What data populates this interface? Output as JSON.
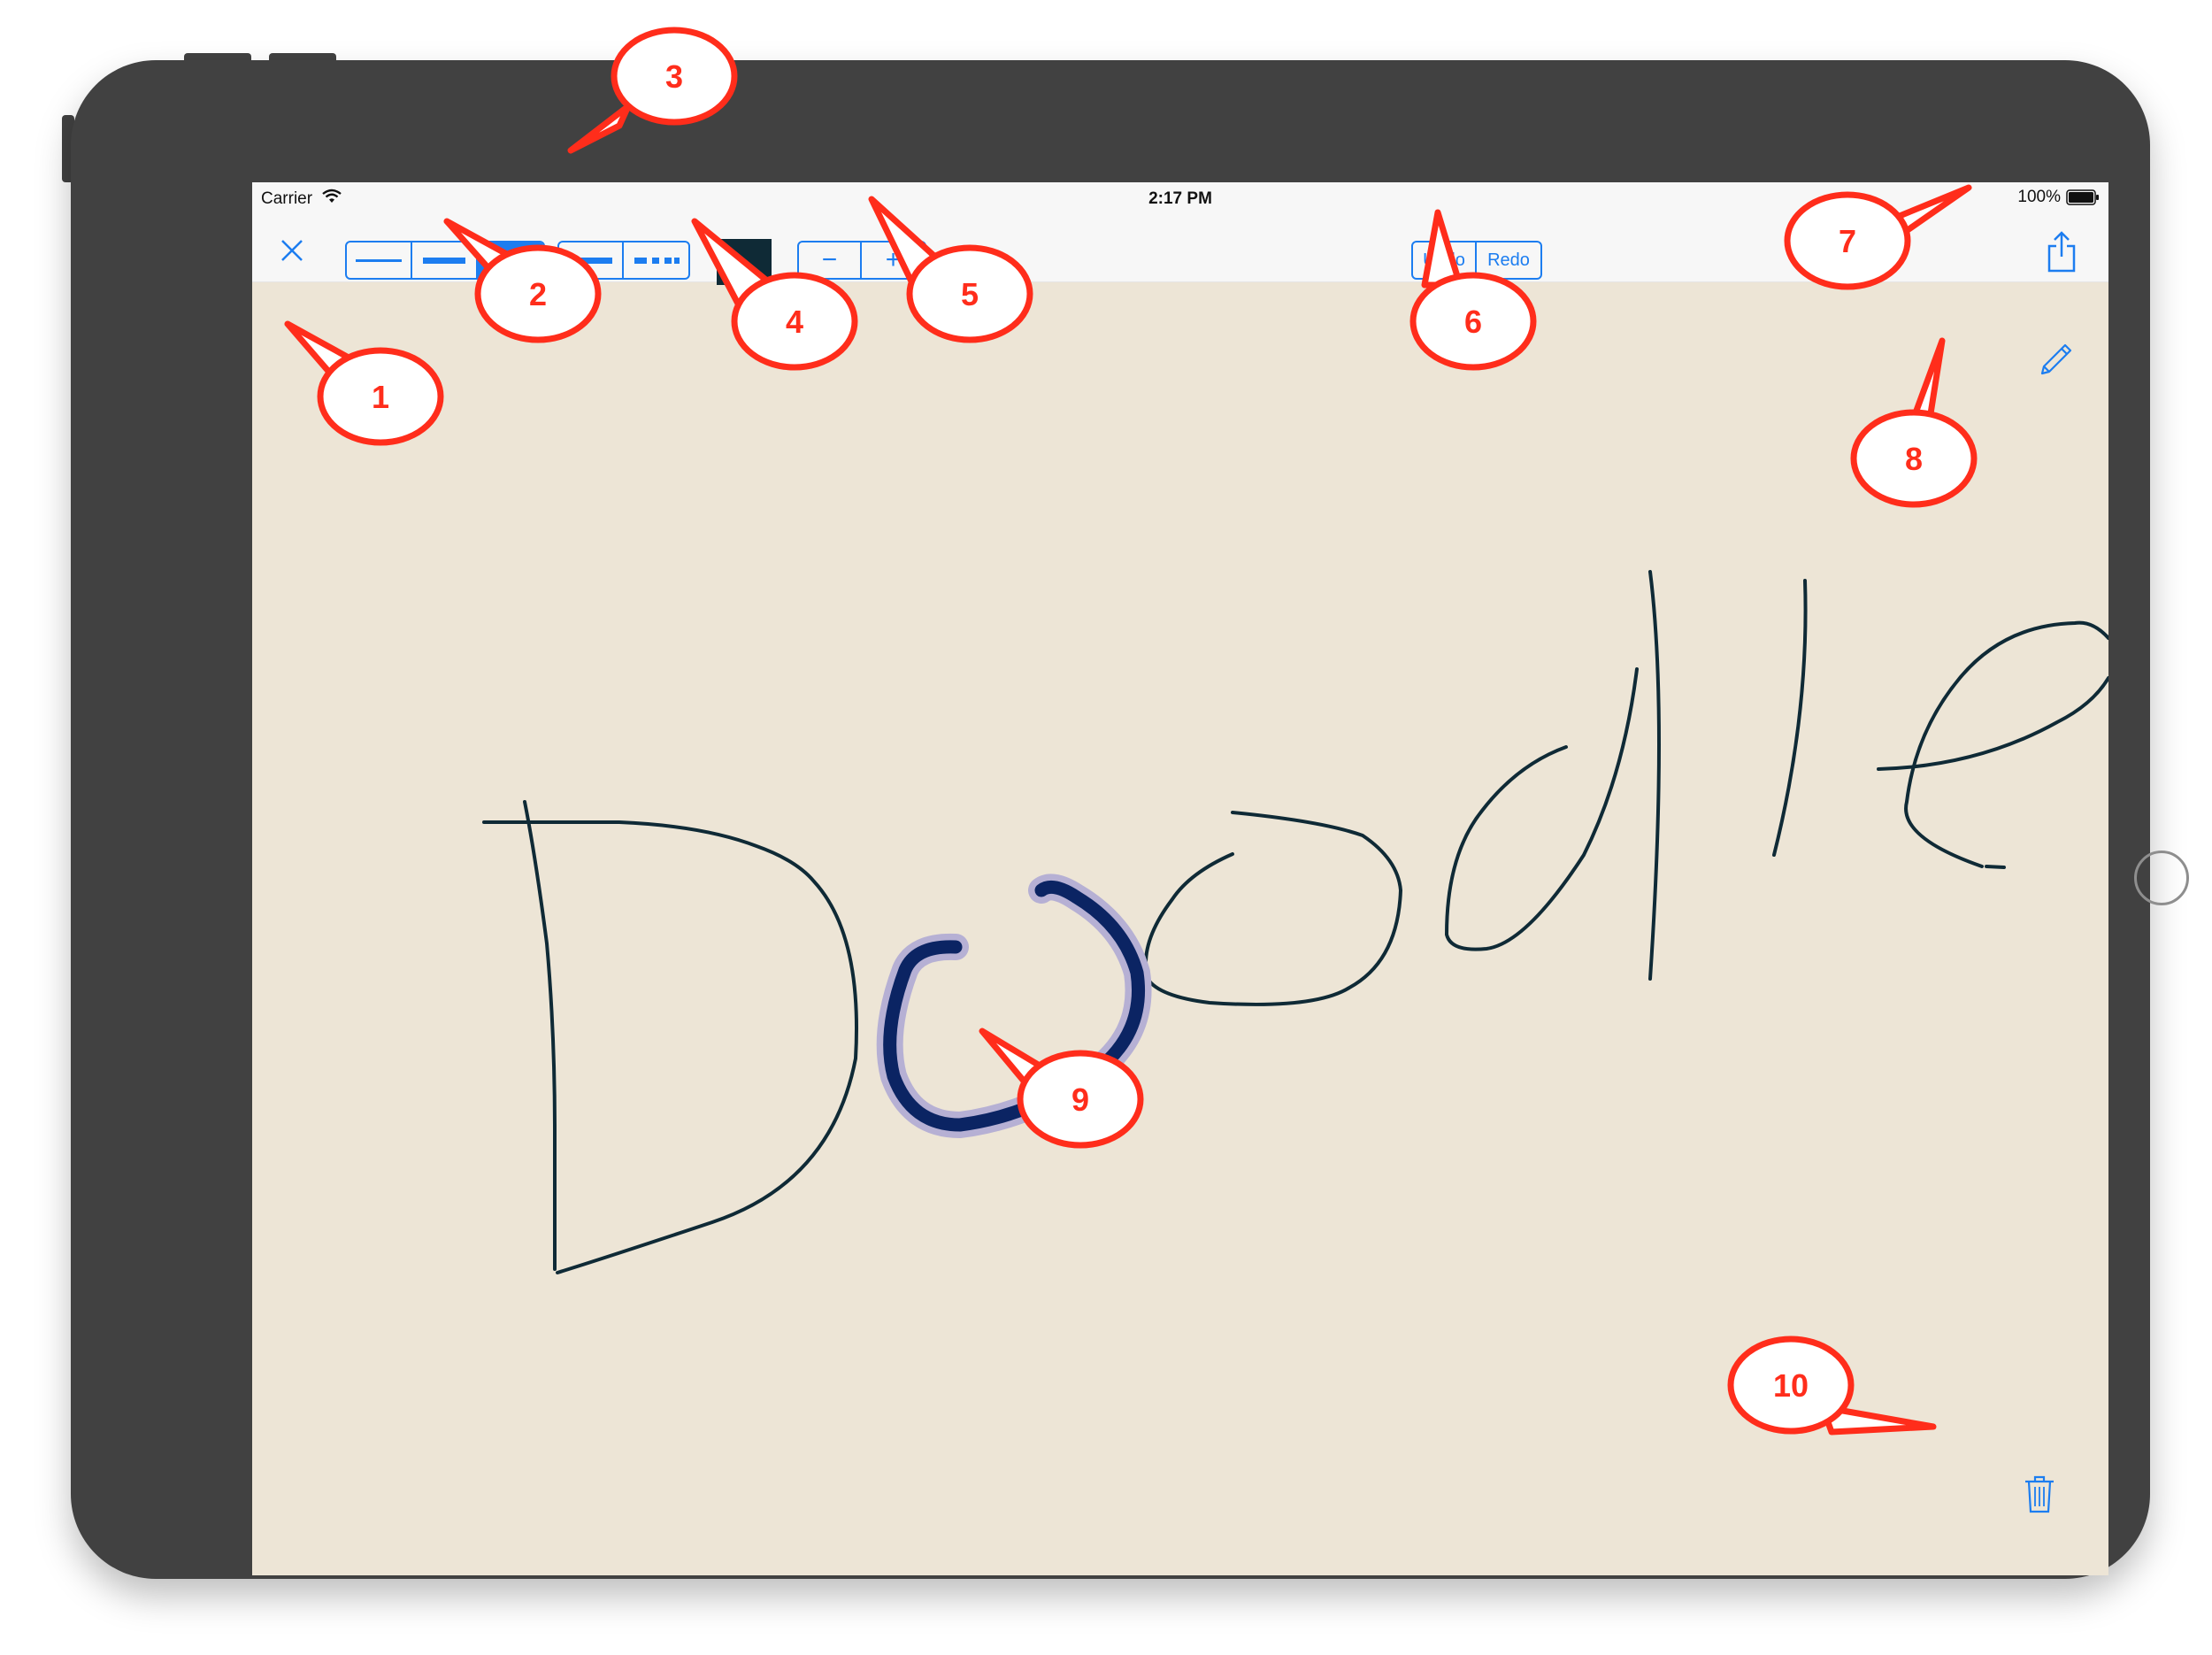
{
  "status_bar": {
    "carrier": "Carrier",
    "time": "2:17 PM",
    "battery": "100%"
  },
  "toolbar": {
    "close_icon": "close-icon",
    "line_widths": [
      "thin",
      "medium",
      "thick"
    ],
    "selected_width": "thick",
    "dash_styles": [
      "solid",
      "dashed"
    ],
    "stroke_color": "#0f2a36",
    "zoom_out_label": "−",
    "zoom_in_label": "+",
    "undo_label": "Undo",
    "redo_label": "Redo",
    "share_icon": "share-icon"
  },
  "canvas": {
    "background": "#ede5d6",
    "ink_color": "#0f2a36",
    "highlight_stroke_color": "#0b2463",
    "up_arrow_icon": "up-arrow-icon",
    "pencil_icon": "pencil-icon",
    "trash_icon": "trash-icon"
  },
  "callouts": [
    "1",
    "2",
    "3",
    "4",
    "5",
    "6",
    "7",
    "8",
    "9",
    "10"
  ],
  "accent_color": "#1c7df0",
  "callout_color": "#ff2d1b"
}
